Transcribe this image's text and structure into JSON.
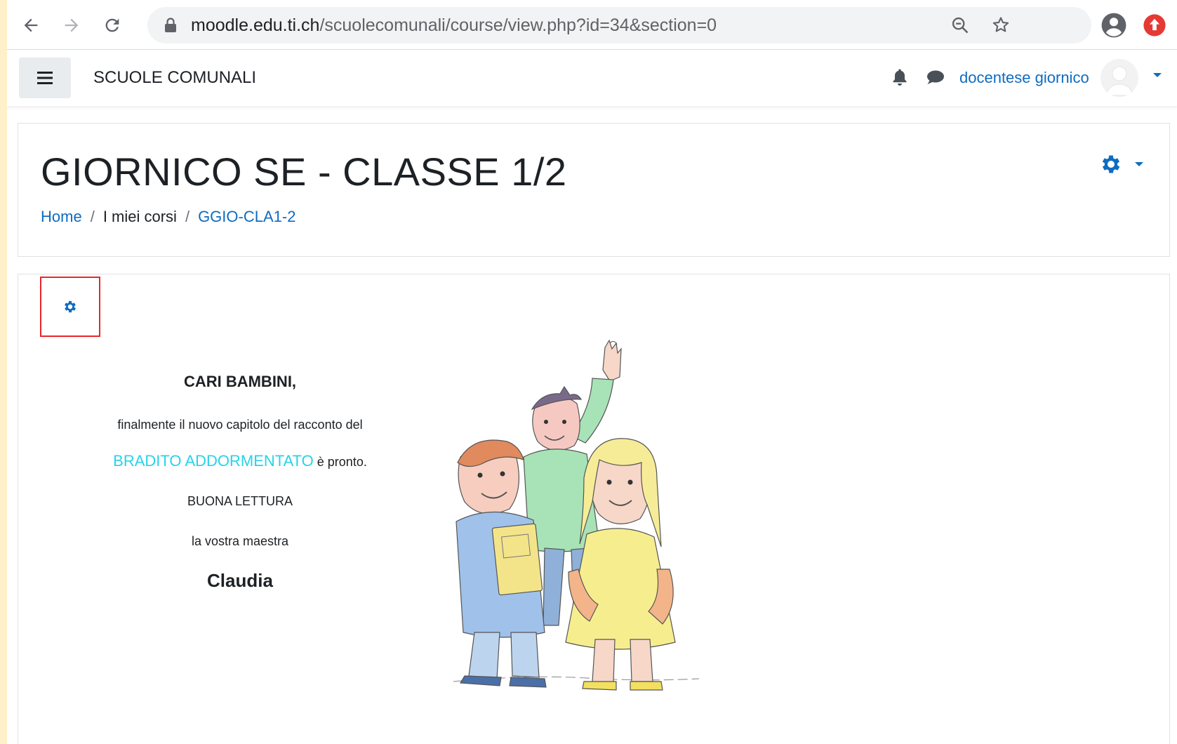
{
  "browser": {
    "url_host": "moodle.edu.ti.ch",
    "url_path": "/scuolecomunali/course/view.php?id=34&section=0"
  },
  "navbar": {
    "site_name": "SCUOLE COMUNALI",
    "user_name": "docentese giornico"
  },
  "header": {
    "title": "GIORNICO SE - CLASSE 1/2",
    "breadcrumb": [
      {
        "label": "Home"
      },
      {
        "label": "I miei corsi"
      },
      {
        "label": "GGIO-CLA1-2"
      }
    ]
  },
  "content": {
    "greeting": "CARI BAMBINI,",
    "line1": "finalmente il nuovo capitolo del racconto del",
    "story_link": "BRADITO ADDORMENTATO",
    "line2_suffix": " è pronto.",
    "line3": "BUONA LETTURA",
    "line4": "la vostra maestra",
    "signature": "Claudia"
  },
  "colors": {
    "link": "#0f6cbf",
    "story_link": "#28d3e8",
    "highlight_box": "#e8272a"
  }
}
